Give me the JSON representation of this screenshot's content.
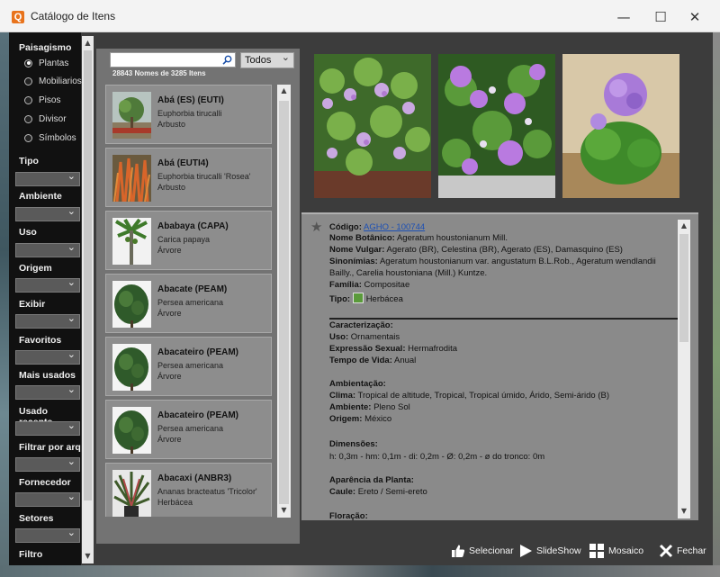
{
  "window": {
    "title": "Catálogo de Itens",
    "icon_letter": "Q",
    "minimize": "—",
    "maximize": "☐",
    "close": "✕"
  },
  "sidebar": {
    "paisagismo_label": "Paisagismo",
    "radio_options": [
      {
        "label": "Plantas",
        "selected": true
      },
      {
        "label": "Mobiliarios",
        "selected": false
      },
      {
        "label": "Pisos",
        "selected": false
      },
      {
        "label": "Divisor",
        "selected": false
      },
      {
        "label": "Símbolos",
        "selected": false
      }
    ],
    "filters": [
      {
        "label": "Tipo"
      },
      {
        "label": "Ambiente"
      },
      {
        "label": "Uso"
      },
      {
        "label": "Origem"
      },
      {
        "label": "Exibir"
      },
      {
        "label": "Favoritos"
      },
      {
        "label": "Mais usados"
      },
      {
        "label": "Usado recente"
      },
      {
        "label": "Filtrar por arq"
      },
      {
        "label": "Fornecedor"
      },
      {
        "label": "Setores"
      },
      {
        "label": "Filtro"
      }
    ]
  },
  "search": {
    "value": "",
    "placeholder": "",
    "filter_value": "Todos",
    "count_text": "28843 Nomes de 3285 Itens"
  },
  "items": [
    {
      "name": "Abá (ES) (EUTI)",
      "botanical": "Euphorbia tirucalli",
      "type": "Arbusto"
    },
    {
      "name": "Abá (EUTI4)",
      "botanical": "Euphorbia tirucalli 'Rosea'",
      "type": "Arbusto"
    },
    {
      "name": "Ababaya (CAPA)",
      "botanical": "Carica papaya",
      "type": "Árvore"
    },
    {
      "name": "Abacate (PEAM)",
      "botanical": "Persea americana",
      "type": "Árvore"
    },
    {
      "name": "Abacateiro (PEAM)",
      "botanical": "Persea americana",
      "type": "Árvore"
    },
    {
      "name": "Abacateiro (PEAM)",
      "botanical": "Persea americana",
      "type": "Árvore"
    },
    {
      "name": "Abacaxi (ANBR3)",
      "botanical": "Ananas bracteatus 'Tricolor'",
      "type": "Herbácea"
    }
  ],
  "detail": {
    "codigo_label": "Código:",
    "codigo_value": "AGHO - 100744",
    "nome_botanico_label": "Nome Botânico:",
    "nome_botanico_value": "Ageratum houstonianum Mill.",
    "nome_vulgar_label": "Nome Vulgar:",
    "nome_vulgar_value": "Agerato (BR), Celestina (BR), Agerato (ES), Damasquino (ES)",
    "sinonimias_label": "Sinonímias:",
    "sinonimias_value_1": "Ageratum houstonianum var. angustatum B.L.Rob., Ageratum wendlandii",
    "sinonimias_value_2": "Bailly., Carelia houstoniana (Mill.) Kuntze.",
    "familia_label": "Família:",
    "familia_value": "Compositae",
    "tipo_label": "Tipo:",
    "tipo_value": "Herbácea",
    "caracterizacao_label": "Caracterização:",
    "uso_label": "Uso:",
    "uso_value": "Ornamentais",
    "expressao_label": "Expressão Sexual:",
    "expressao_value": "Hermafrodita",
    "tempo_label": "Tempo de Vida:",
    "tempo_value": "Anual",
    "ambientacao_label": "Ambientação:",
    "clima_label": "Clima:",
    "clima_value": "Tropical de altitude, Tropical, Tropical úmido, Árido, Semi-árido (B)",
    "ambiente_label": "Ambiente:",
    "ambiente_value": "Pleno Sol",
    "origem_label": "Origem:",
    "origem_value": "México",
    "dimensoes_label": "Dimensões:",
    "dimensoes_value": "h: 0,3m - hm: 0,1m - di: 0,2m - Ø: 0,2m - ø do tronco: 0m",
    "aparencia_label": "Aparência da Planta:",
    "caule_label": "Caule:",
    "caule_value": "Ereto / Semi-ereto",
    "floracao_label": "Floração:"
  },
  "buttons": {
    "selecionar": "Selecionar",
    "slideshow": "SlideShow",
    "mosaico": "Mosaico",
    "fechar": "Fechar"
  }
}
